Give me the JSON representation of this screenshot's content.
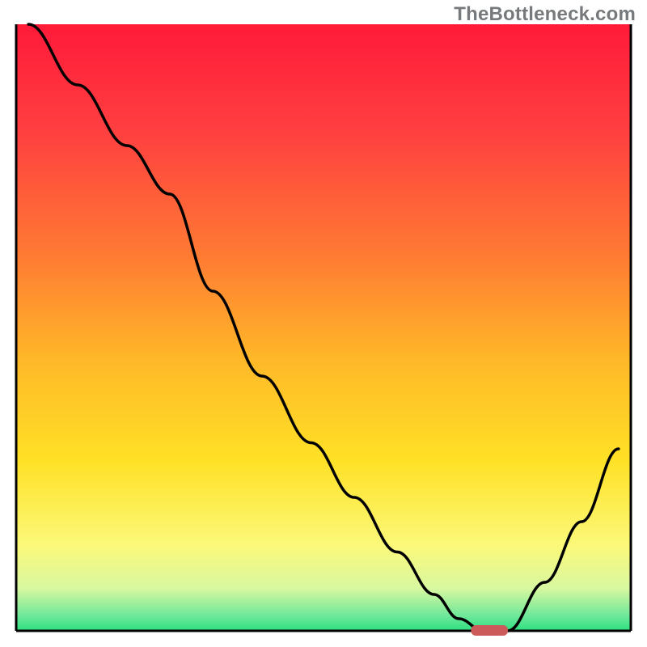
{
  "watermark": "TheBottleneck.com",
  "chart_data": {
    "type": "line",
    "title": "",
    "xlabel": "",
    "ylabel": "",
    "xlim": [
      0,
      100
    ],
    "ylim": [
      0,
      100
    ],
    "axes_visible": false,
    "grid": false,
    "background_gradient": [
      {
        "pos": 0.0,
        "color": "#ff1a3a"
      },
      {
        "pos": 0.18,
        "color": "#ff4040"
      },
      {
        "pos": 0.38,
        "color": "#ff7a33"
      },
      {
        "pos": 0.55,
        "color": "#ffb728"
      },
      {
        "pos": 0.72,
        "color": "#ffe126"
      },
      {
        "pos": 0.86,
        "color": "#fbf97a"
      },
      {
        "pos": 0.93,
        "color": "#d8f8a0"
      },
      {
        "pos": 0.975,
        "color": "#6fe89a"
      },
      {
        "pos": 1.0,
        "color": "#2ddf80"
      }
    ],
    "series": [
      {
        "name": "bottleneck-curve",
        "color": "#000000",
        "x": [
          2,
          10,
          18,
          25,
          32,
          40,
          48,
          55,
          62,
          68,
          72,
          76,
          80,
          86,
          92,
          98
        ],
        "y": [
          100,
          90,
          80,
          72,
          56,
          42,
          31,
          22,
          13,
          6,
          2,
          0,
          0,
          8,
          18,
          30
        ]
      }
    ],
    "marker": {
      "name": "optimal-point",
      "x": 77,
      "y": 0,
      "width": 6,
      "color": "#cc5a5a"
    }
  }
}
